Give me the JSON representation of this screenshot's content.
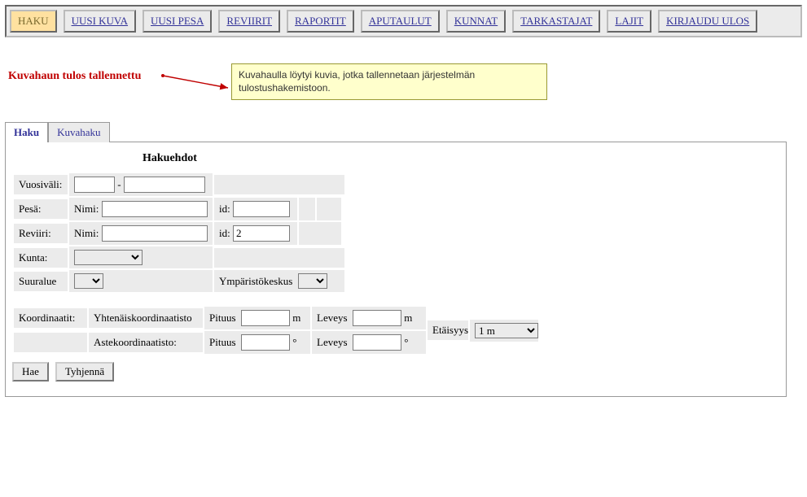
{
  "topnav": {
    "items": [
      {
        "label": "HAKU",
        "active": true
      },
      {
        "label": "UUSI KUVA"
      },
      {
        "label": "UUSI PESA"
      },
      {
        "label": "REVIIRIT"
      },
      {
        "label": "RAPORTIT"
      },
      {
        "label": "APUTAULUT"
      },
      {
        "label": "KUNNAT"
      },
      {
        "label": "TARKASTAJAT"
      },
      {
        "label": "LAJIT"
      },
      {
        "label": "KIRJAUDU ULOS"
      }
    ]
  },
  "message": "Kuvahaun tulos tallennettu",
  "tooltip": "Kuvahaulla löytyi kuvia, jotka tallennetaan järjestelmän tulostushakemistoon.",
  "tabs": [
    {
      "label": "Haku",
      "active": true
    },
    {
      "label": "Kuvahaku"
    }
  ],
  "form": {
    "title": "Hakuehdot",
    "labels": {
      "vuosivali": "Vuosiväli:",
      "dash": "-",
      "pesa": "Pesä:",
      "nimi": "Nimi:",
      "id": "id:",
      "reviiri": "Reviiri:",
      "kunta": "Kunta:",
      "suuralue": "Suuralue",
      "ymp": "Ympäristökeskus",
      "koord": "Koordinaatit:",
      "yhtenais": "Yhtenäiskoordinaatisto",
      "aste": "Astekoordinaatisto:",
      "pituus": "Pituus",
      "leveys": "Leveys",
      "m": "m",
      "deg": "°",
      "etaisyys": "Etäisyys"
    },
    "values": {
      "vuosi_from": "",
      "vuosi_to": "",
      "pesa_nimi": "",
      "pesa_id": "",
      "reviiri_nimi": "",
      "reviiri_id": "2",
      "kunta": "",
      "suuralue": "",
      "ymp": "",
      "yht_pituus": "",
      "yht_leveys": "",
      "aste_pituus": "",
      "aste_leveys": "",
      "etaisyys": "1 m"
    },
    "buttons": {
      "hae": "Hae",
      "tyhjenna": "Tyhjennä"
    }
  }
}
